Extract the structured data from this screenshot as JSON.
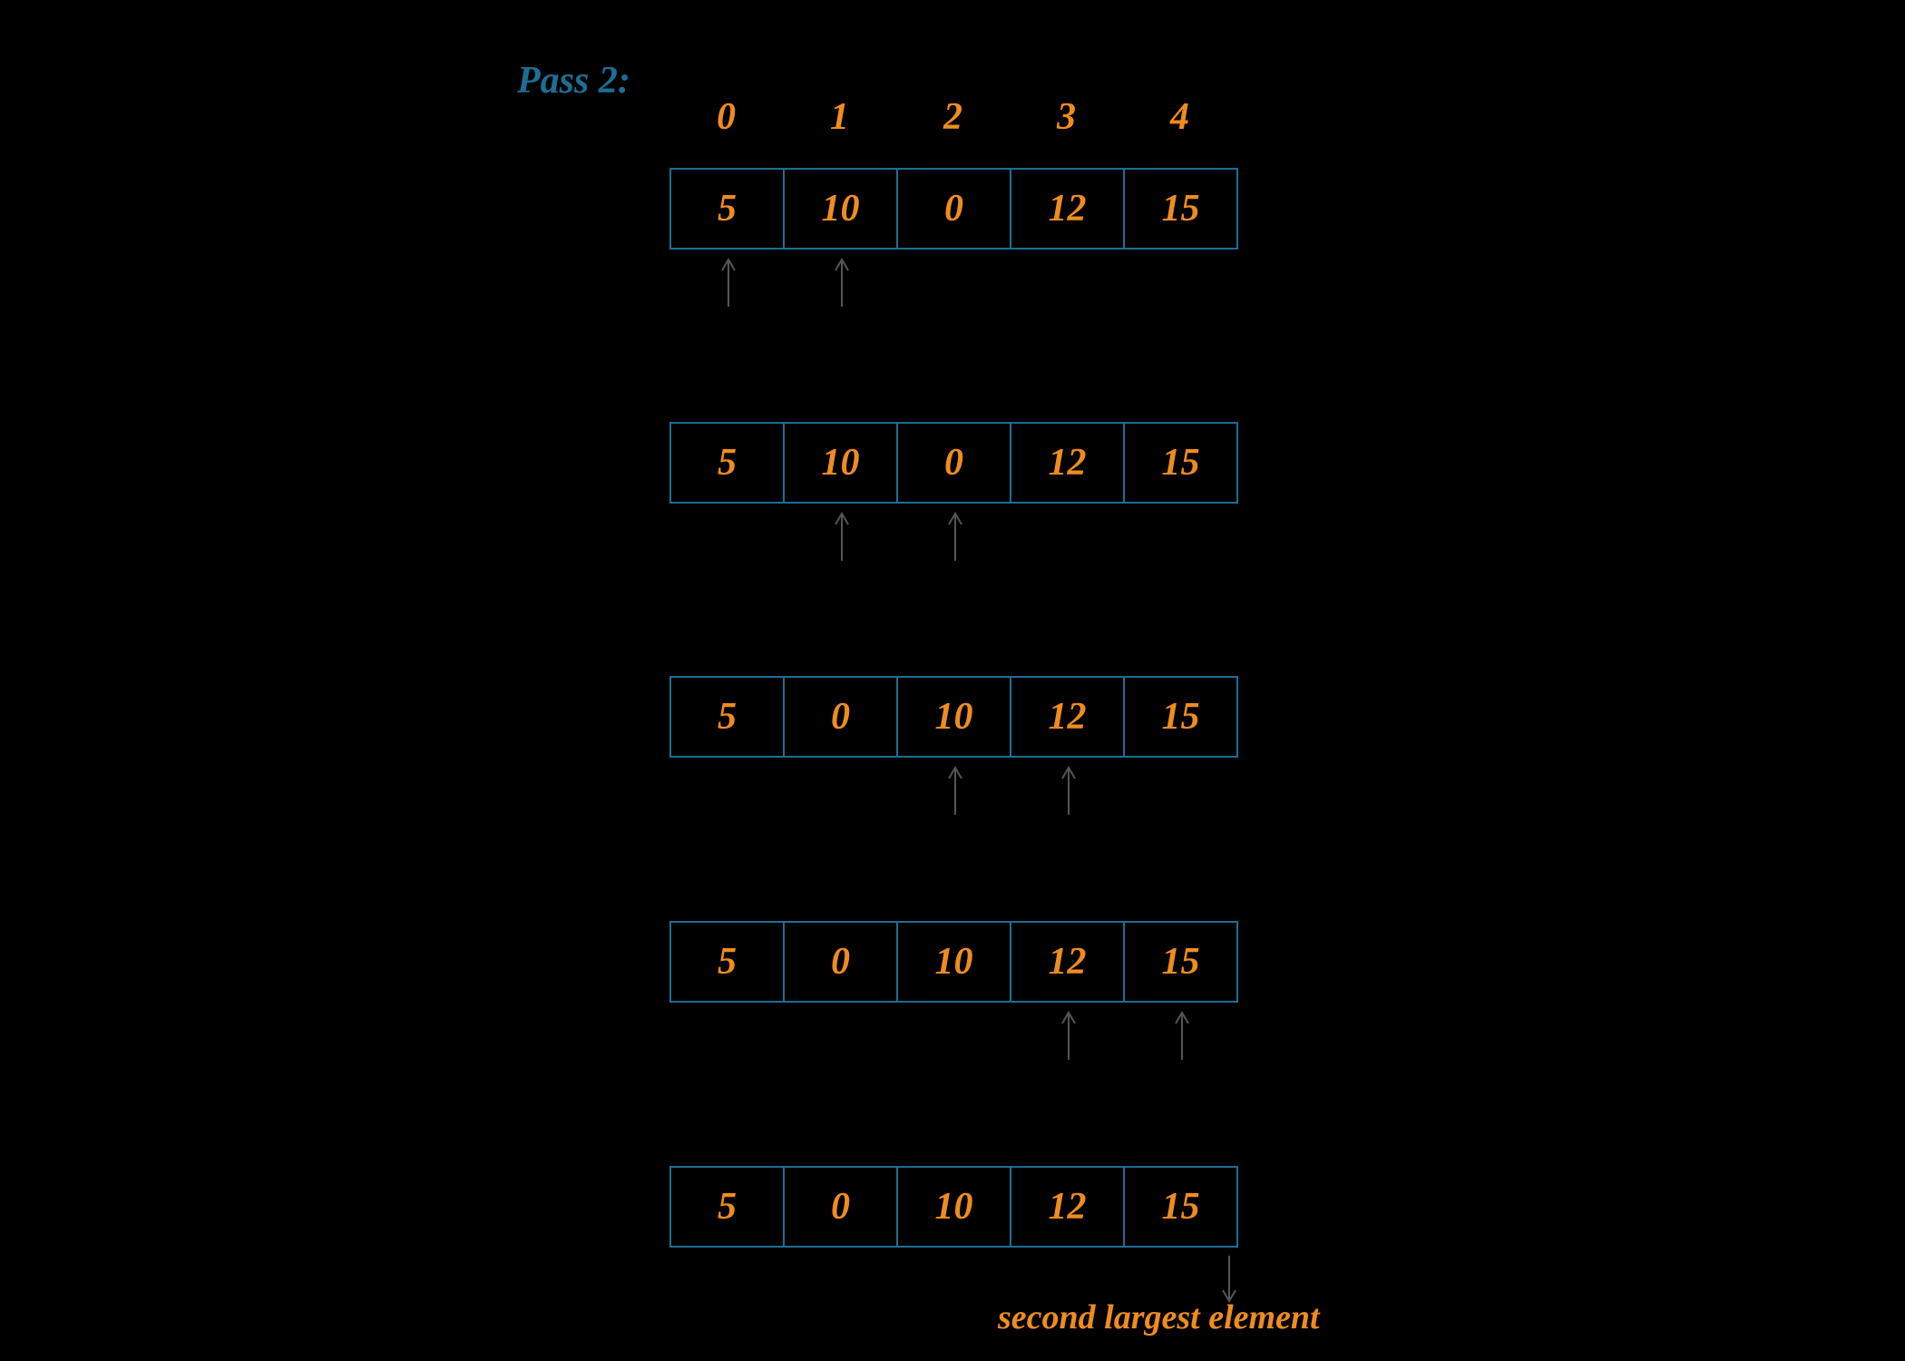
{
  "title": "Pass 2:",
  "indices": [
    "0",
    "1",
    "2",
    "3",
    "4"
  ],
  "arrays": [
    [
      "5",
      "10",
      "0",
      "12",
      "15"
    ],
    [
      "5",
      "10",
      "0",
      "12",
      "15"
    ],
    [
      "5",
      "0",
      "10",
      "12",
      "15"
    ],
    [
      "5",
      "0",
      "10",
      "12",
      "15"
    ],
    [
      "5",
      "0",
      "10",
      "12",
      "15"
    ]
  ],
  "annotation": "second largest element",
  "colors": {
    "accent": "#ef8c1f",
    "border": "#1e6e94",
    "title": "#1e6e94",
    "arrow": "#555"
  },
  "chart_data": {
    "type": "table",
    "description": "Bubble sort pass 2 on a 5-element array; arrows point to the pair being compared at each step; final arrow marks position of second largest element after the pass.",
    "index_labels": [
      0,
      1,
      2,
      3,
      4
    ],
    "steps": [
      {
        "array": [
          5,
          10,
          0,
          12,
          15
        ],
        "compare": [
          0,
          1
        ]
      },
      {
        "array": [
          5,
          10,
          0,
          12,
          15
        ],
        "compare": [
          1,
          2
        ]
      },
      {
        "array": [
          5,
          0,
          10,
          12,
          15
        ],
        "compare": [
          2,
          3
        ]
      },
      {
        "array": [
          5,
          0,
          10,
          12,
          15
        ],
        "compare": [
          3,
          4
        ]
      },
      {
        "array": [
          5,
          0,
          10,
          12,
          15
        ],
        "result_arrow": 4,
        "result_label": "second largest element"
      }
    ]
  }
}
